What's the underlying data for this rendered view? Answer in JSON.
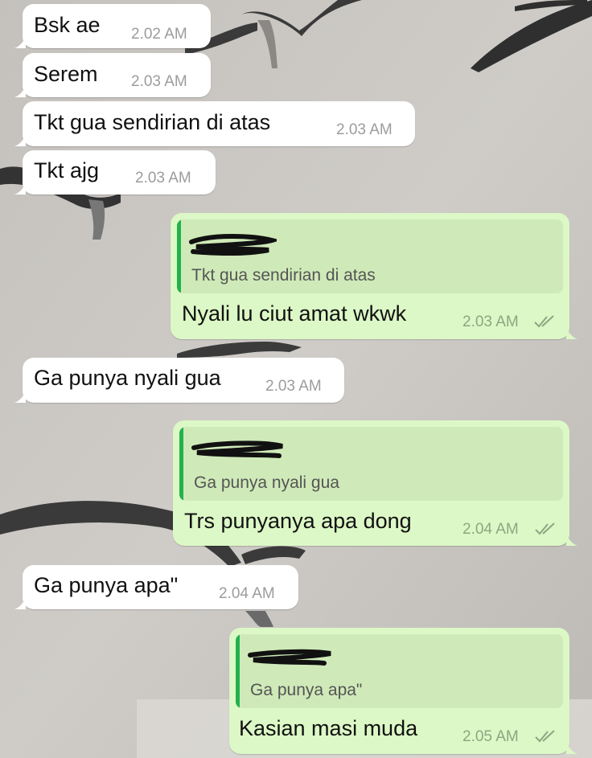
{
  "chat": {
    "messages": [
      {
        "direction": "incoming",
        "text": "Bsk ae",
        "time": "2.02 AM"
      },
      {
        "direction": "incoming",
        "text": "Serem",
        "time": "2.03 AM"
      },
      {
        "direction": "incoming",
        "text": "Tkt gua sendirian di atas",
        "time": "2.03 AM"
      },
      {
        "direction": "incoming",
        "text": "Tkt ajg",
        "time": "2.03 AM"
      },
      {
        "direction": "outgoing",
        "quoted_text": "Tkt gua sendirian di atas",
        "text": "Nyali lu ciut amat wkwk",
        "time": "2.03 AM"
      },
      {
        "direction": "incoming",
        "text": "Ga punya nyali gua",
        "time": "2.03 AM"
      },
      {
        "direction": "outgoing",
        "quoted_text": "Ga punya nyali gua",
        "text": "Trs punyanya apa dong",
        "time": "2.04 AM"
      },
      {
        "direction": "incoming",
        "text": "Ga punya apa\"",
        "time": "2.04 AM"
      },
      {
        "direction": "outgoing",
        "quoted_text": "Ga punya apa\"",
        "text": "Kasian masi muda",
        "time": "2.05 AM"
      }
    ]
  },
  "colors": {
    "incoming_bubble": "#ffffff",
    "outgoing_bubble": "#dcf8c6",
    "quote_bar": "#23b14d",
    "read_ticks": "#8fa582"
  },
  "icons": {
    "read_receipt": "double-check-icon",
    "quoted_author": "redacted-name-scribble"
  }
}
